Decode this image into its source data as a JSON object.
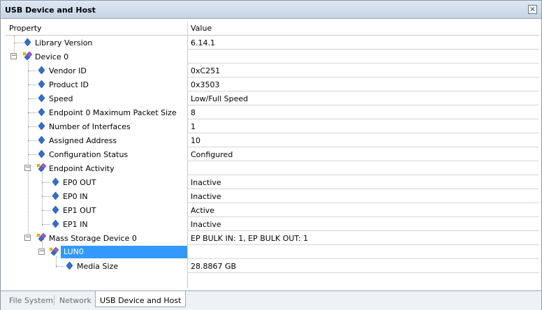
{
  "window": {
    "title": "USB Device and Host",
    "close_glyph": "×"
  },
  "columns": {
    "property": "Property",
    "value": "Value"
  },
  "rows": [
    {
      "label": "Library Version",
      "value": "6.14.1"
    },
    {
      "label": "Device 0",
      "value": ""
    },
    {
      "label": "Vendor ID",
      "value": "0xC251"
    },
    {
      "label": "Product ID",
      "value": "0x3503"
    },
    {
      "label": "Speed",
      "value": "Low/Full Speed"
    },
    {
      "label": "Endpoint 0 Maximum Packet Size",
      "value": "8"
    },
    {
      "label": "Number of Interfaces",
      "value": "1"
    },
    {
      "label": "Assigned Address",
      "value": "10"
    },
    {
      "label": "Configuration Status",
      "value": "Configured"
    },
    {
      "label": "Endpoint Activity",
      "value": ""
    },
    {
      "label": "EP0 OUT",
      "value": "Inactive"
    },
    {
      "label": "EP0 IN",
      "value": "Inactive"
    },
    {
      "label": "EP1 OUT",
      "value": "Active"
    },
    {
      "label": "EP1 IN",
      "value": "Inactive"
    },
    {
      "label": "Mass Storage Device 0",
      "value": "EP BULK IN: 1, EP BULK OUT: 1"
    },
    {
      "label": "LUN0",
      "value": ""
    },
    {
      "label": "Media Size",
      "value": "28.8867 GB"
    }
  ],
  "tabs": [
    "File System",
    "Network",
    "USB Device and Host"
  ],
  "icons": {
    "property": "diamond-icon",
    "group": "folder-props-icon"
  },
  "colors": {
    "selection": "#3399ff",
    "diamond": "#2f6fd6",
    "titlebar": "#c4d3e3"
  }
}
